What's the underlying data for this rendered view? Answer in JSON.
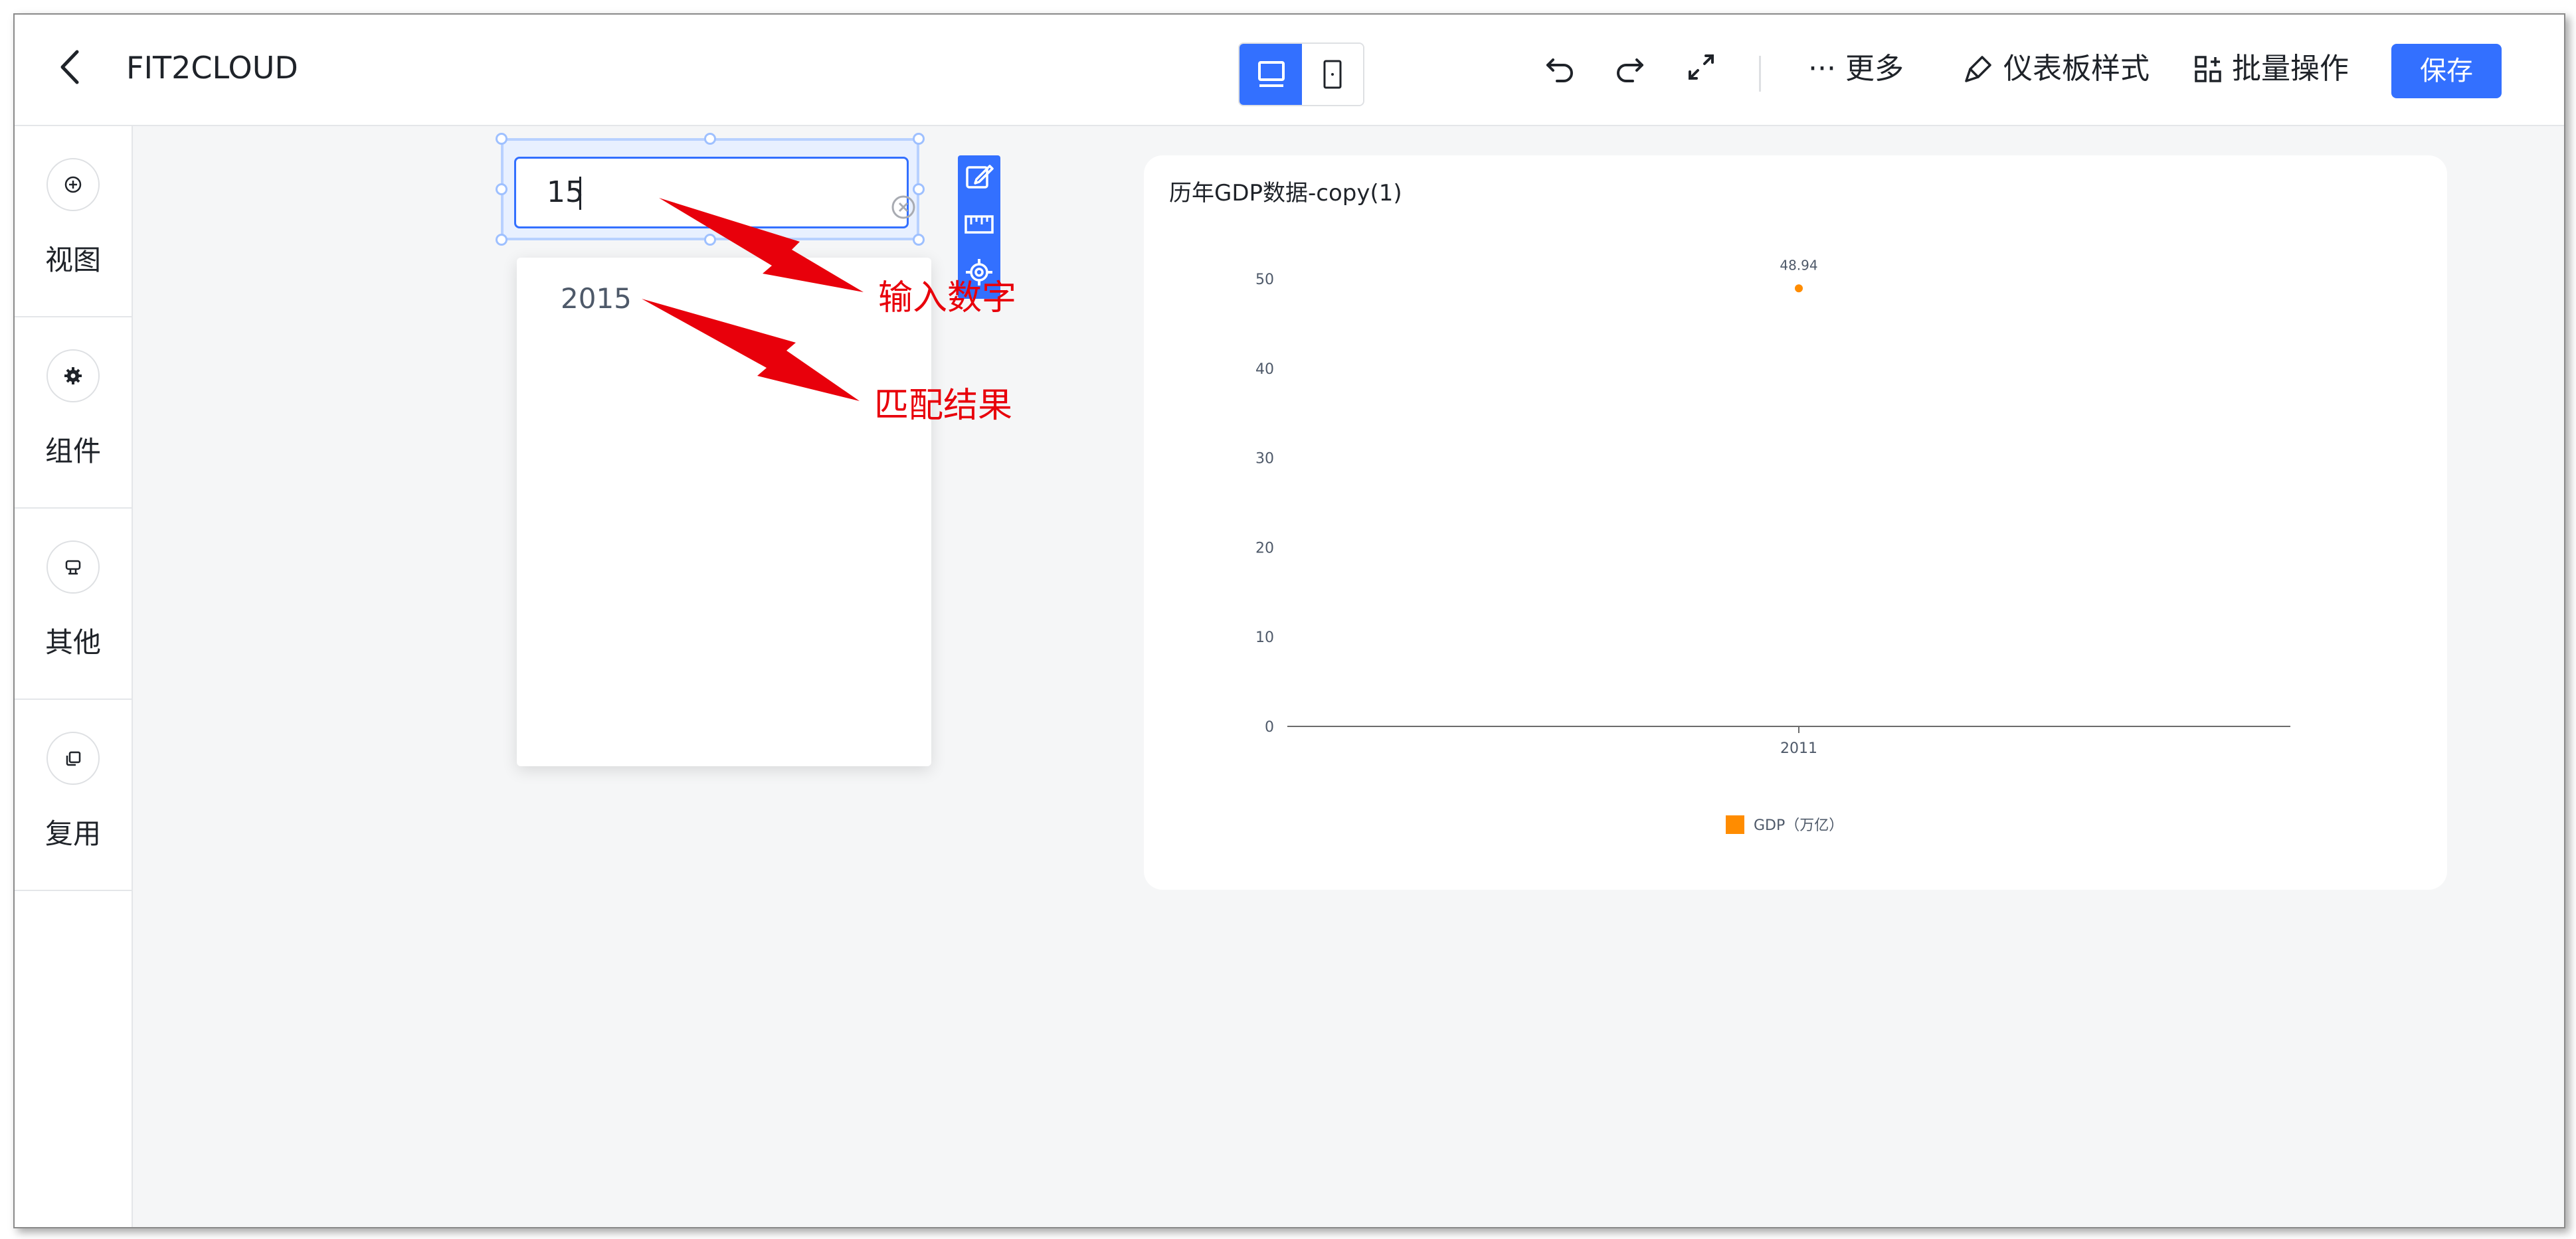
{
  "header": {
    "app_title": "FIT2CLOUD",
    "more_label": "··· 更多",
    "style_label": "仪表板样式",
    "batch_label": "批量操作",
    "save_label": "保存"
  },
  "sidebar": {
    "items": [
      {
        "label": "视图",
        "icon": "plus-circle-icon"
      },
      {
        "label": "组件",
        "icon": "gear-icon"
      },
      {
        "label": "其他",
        "icon": "stamp-icon"
      },
      {
        "label": "复用",
        "icon": "copy-icon"
      }
    ]
  },
  "filter_widget": {
    "input_value": "15",
    "options": [
      "2015"
    ]
  },
  "chart": {
    "title": "历年GDP数据-copy(1)"
  },
  "chart_data": {
    "type": "scatter",
    "categories": [
      "2011"
    ],
    "series": [
      {
        "name": "GDP（万亿）",
        "values": [
          48.94
        ],
        "color": "#ff8c00"
      }
    ],
    "ylim": [
      0,
      50
    ],
    "yticks": [
      0,
      10,
      20,
      30,
      40,
      50
    ],
    "data_labels": [
      "48.94"
    ],
    "legend_position": "bottom"
  },
  "annotations": {
    "input_hint": "输入数字",
    "match_hint": "匹配结果"
  },
  "colors": {
    "accent": "#3370ff",
    "annotation": "#e8000b",
    "series": "#ff8c00"
  }
}
